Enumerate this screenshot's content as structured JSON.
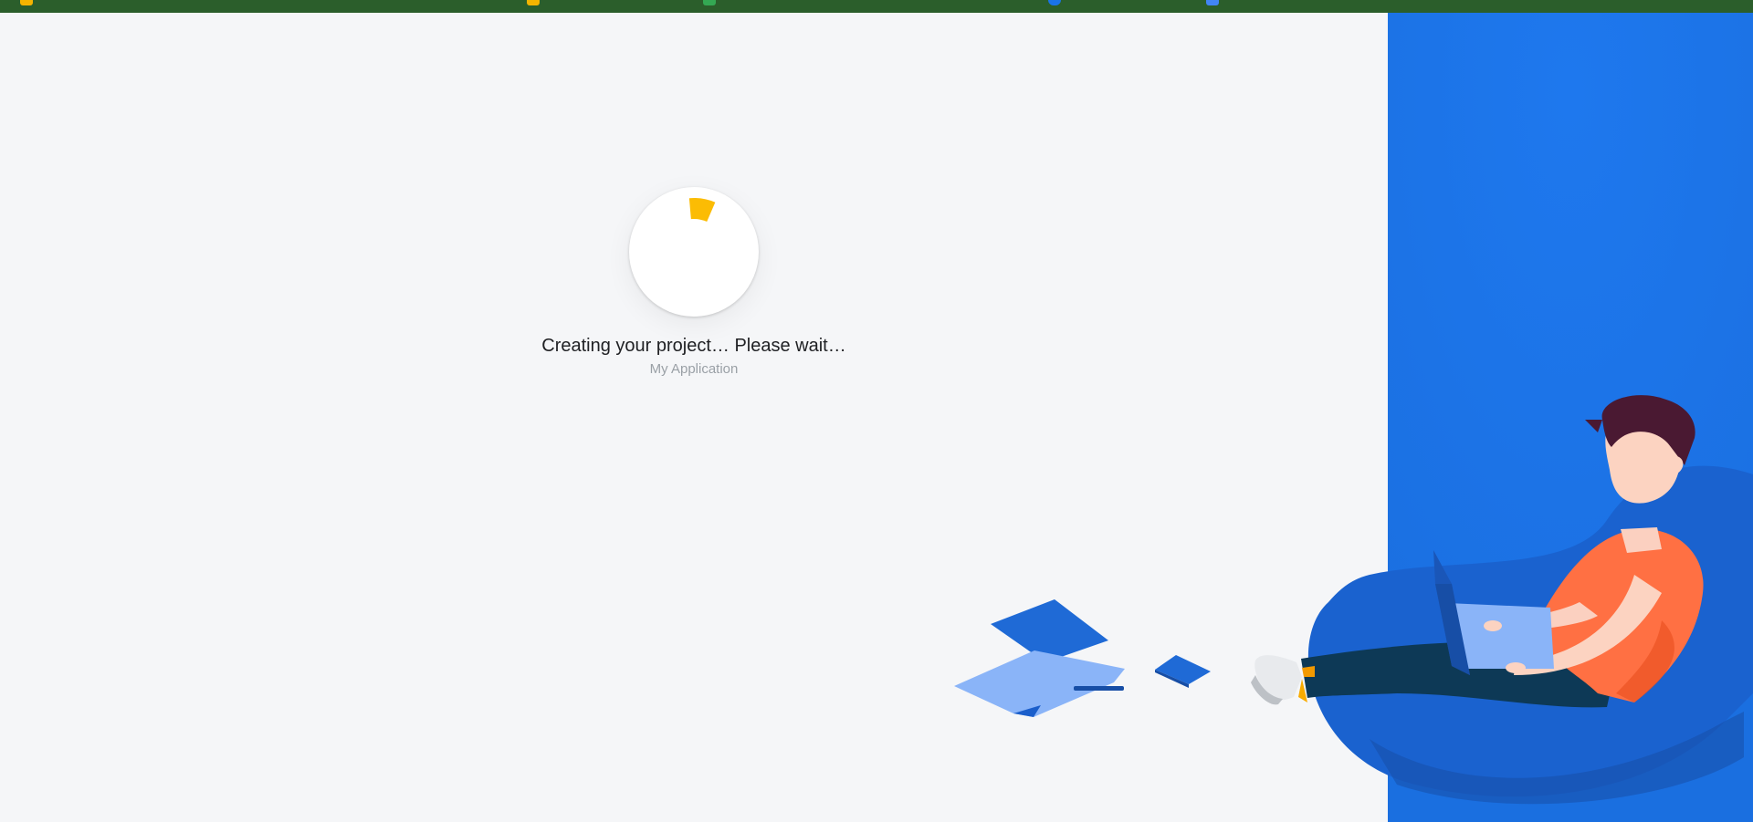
{
  "topbar": {
    "icons": [
      {
        "name": "tab-favicon-firebase-icon",
        "color": "#f4b400"
      },
      {
        "name": "tab-favicon-firebase-icon-2",
        "color": "#f4b400"
      },
      {
        "name": "tab-favicon-sheets-icon",
        "color": "#34a853"
      },
      {
        "name": "tab-favicon-globe-icon",
        "color": "#1a73e8"
      },
      {
        "name": "tab-favicon-docs-icon",
        "color": "#4285f4"
      }
    ]
  },
  "loader": {
    "accent_color": "#fbbc04",
    "icon": "progress-spinner-icon"
  },
  "status": {
    "message": "Creating your project… Please wait…",
    "project_name": "My Application"
  },
  "colors": {
    "panel": "#1b73e8",
    "background": "#f5f6f8"
  }
}
